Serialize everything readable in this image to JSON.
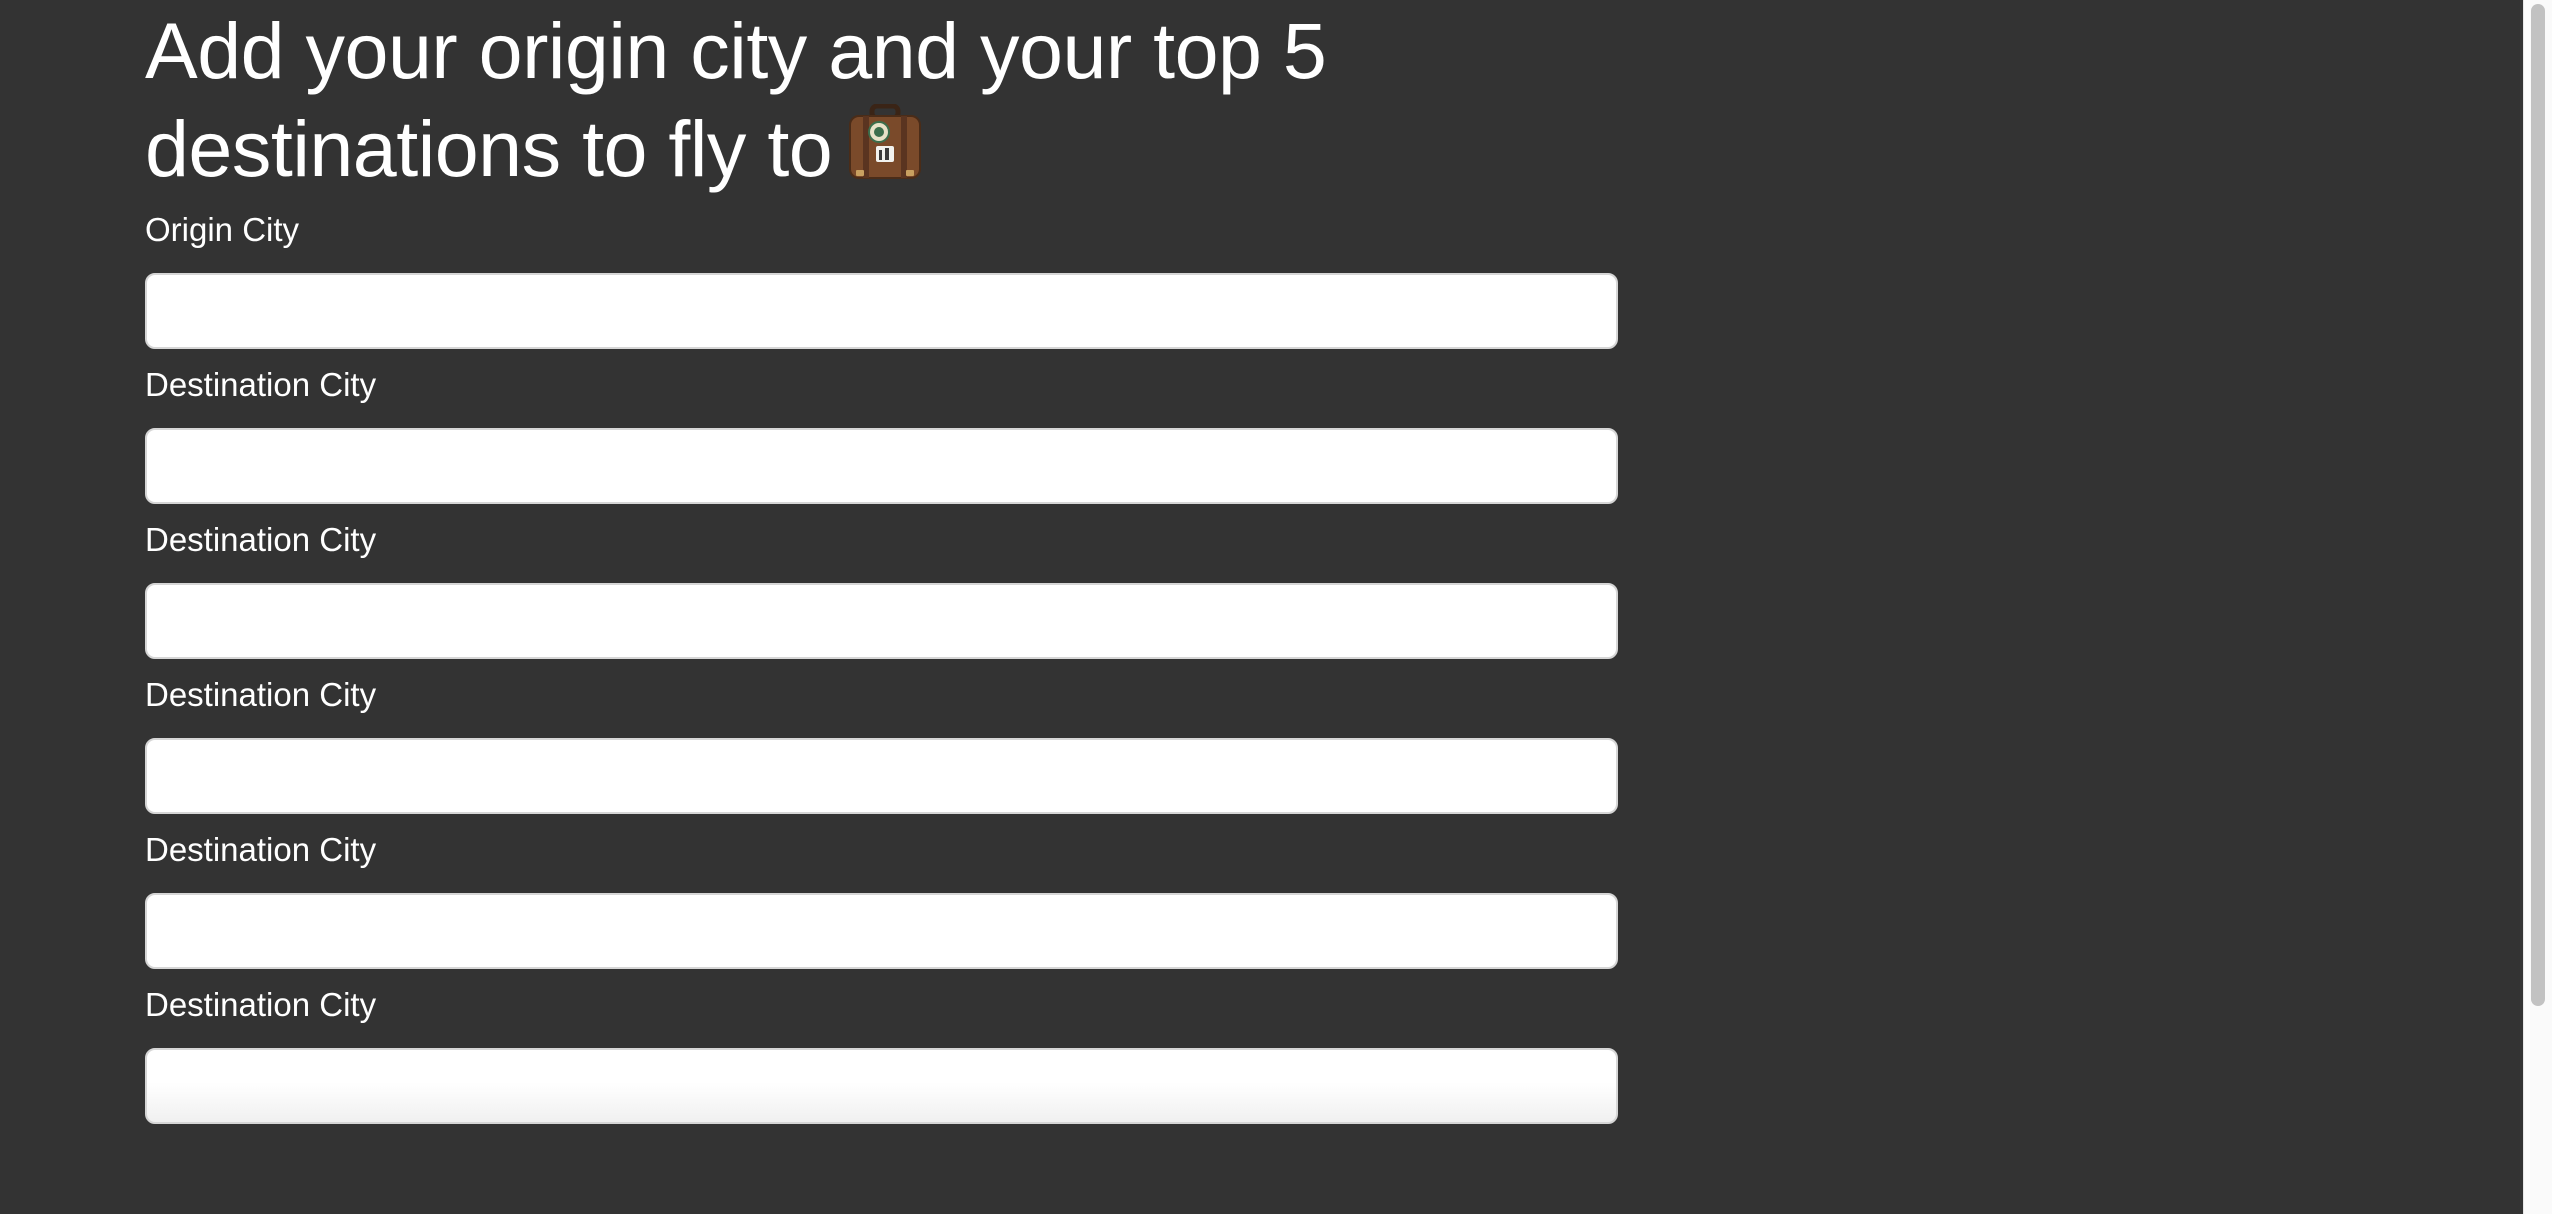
{
  "form": {
    "title": "Add your origin city and your top 5 destinations to fly to",
    "title_emoji": "suitcase-icon",
    "origin": {
      "label": "Origin City",
      "value": ""
    },
    "destinations": [
      {
        "label": "Destination City",
        "value": ""
      },
      {
        "label": "Destination City",
        "value": ""
      },
      {
        "label": "Destination City",
        "value": ""
      },
      {
        "label": "Destination City",
        "value": ""
      },
      {
        "label": "Destination City",
        "value": ""
      }
    ]
  },
  "colors": {
    "background": "#333333",
    "text": "#ffffff",
    "input_background": "#ffffff",
    "input_border": "#d6d6d6",
    "scrollbar_thumb": "#c2c2c2"
  }
}
